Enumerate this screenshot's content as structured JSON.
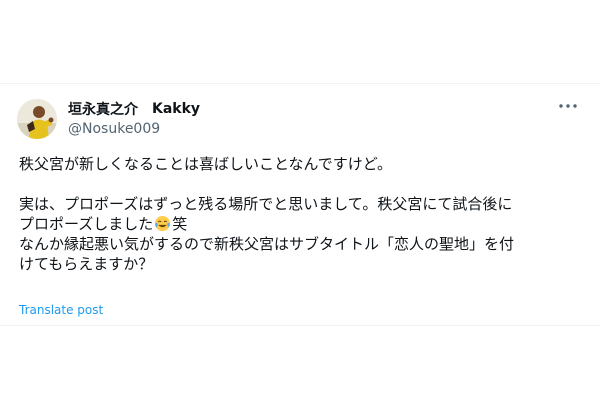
{
  "tweet": {
    "display_name": "垣永真之介",
    "display_name_alt": "Kakky",
    "handle": "@Nosuke009",
    "more_icon": "more-horizontal-icon",
    "avatar_icon": "profile-avatar",
    "lines": {
      "l1": "秩父宮が新しくなることは喜ばしいことなんですけど。",
      "l3": "実は、プロポーズはずっと残る場所でと思いまして。秩父宮にて試合後に",
      "l4a": "プロポーズしました",
      "l4_emoji": "face-with-tears-of-joy-emoji",
      "l4b": "笑",
      "l5": "なんか縁起悪い気がするので新秩父宮はサブタイトル「恋人の聖地」を付",
      "l6": "けてもらえますか？"
    },
    "translate_label": "Translate post",
    "colors": {
      "text": "#0f1419",
      "secondary": "#536471",
      "link": "#1d9bf0"
    }
  }
}
